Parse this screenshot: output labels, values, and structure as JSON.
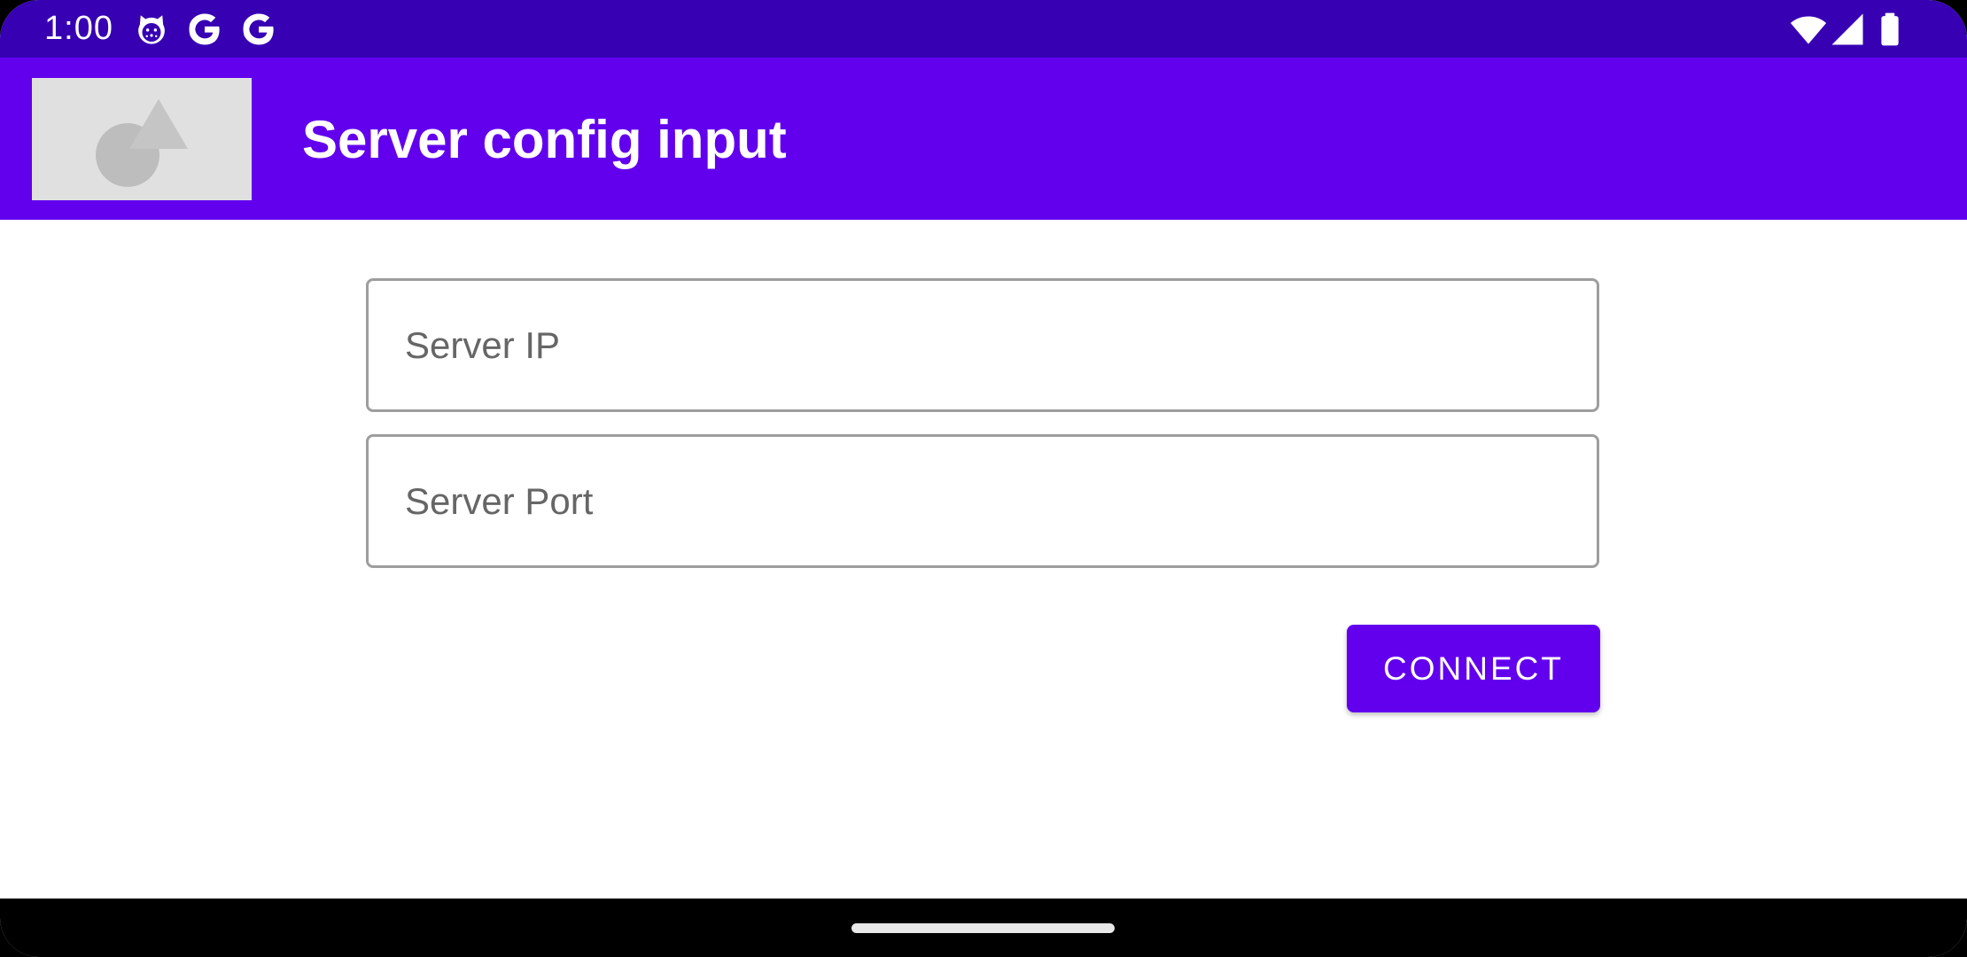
{
  "status_bar": {
    "time": "1:00",
    "icons_left": [
      "cat-notification-icon",
      "google-icon",
      "google-icon"
    ],
    "icons_right": [
      "wifi-icon",
      "cellular-signal-icon",
      "battery-icon"
    ]
  },
  "app_bar": {
    "logo_icon": "image-placeholder-icon",
    "title": "Server config input"
  },
  "form": {
    "server_ip": {
      "value": "",
      "placeholder": "Server IP"
    },
    "server_port": {
      "value": "",
      "placeholder": "Server Port"
    },
    "connect_label": "CONNECT"
  },
  "colors": {
    "status_bar": "#3700b3",
    "primary": "#6200ee",
    "field_border": "#9e9e9e",
    "placeholder_text": "#666666"
  }
}
